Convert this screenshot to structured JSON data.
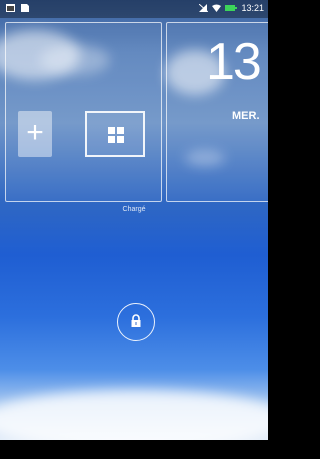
{
  "status_bar": {
    "left_icons": [
      "gallery-icon",
      "sim-icon"
    ],
    "right_icons": [
      "no-sim-icon",
      "wifi-icon",
      "battery-charging-icon"
    ],
    "time": "13:21",
    "battery_color": "#3cd45a"
  },
  "lockscreen": {
    "charge_label": "Chargé",
    "clock_value": "13",
    "day_label": "MER."
  },
  "widgets": {
    "add_symbol": "+",
    "icons": [
      "add-widget-icon",
      "widgets-grid-icon",
      "lock-icon"
    ]
  }
}
